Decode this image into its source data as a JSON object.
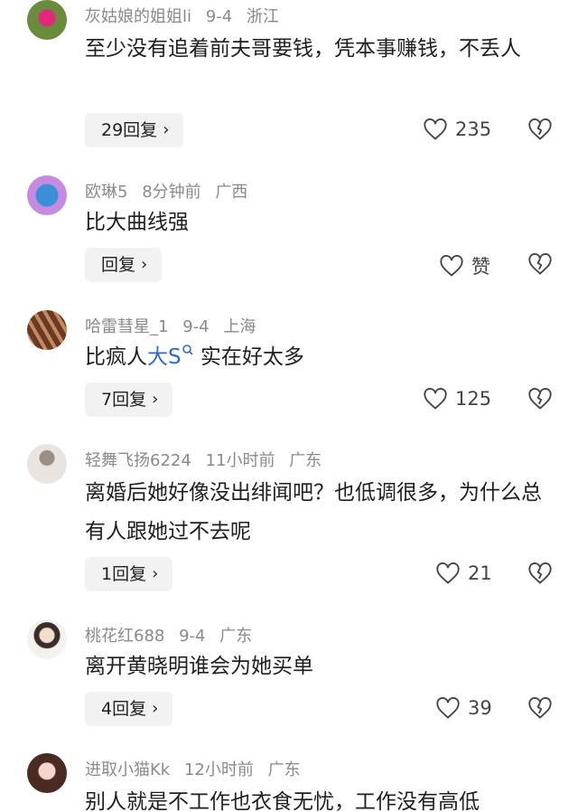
{
  "comments": [
    {
      "user": "灰姑娘的姐姐li",
      "time": "9-4",
      "location": "浙江",
      "text": "至少没有追着前夫哥要钱，凭本事赚钱，不丢人",
      "reply_label": "29回复",
      "likes": "235"
    },
    {
      "user": "欧琳5",
      "time": "8分钟前",
      "location": "广西",
      "text": "比大曲线强",
      "reply_label": "回复",
      "likes": "赞"
    },
    {
      "user": "哈雷彗星_1",
      "time": "9-4",
      "location": "上海",
      "text_before": "比疯人",
      "mention": "大S",
      "text_after": " 实在好太多",
      "reply_label": "7回复",
      "likes": "125"
    },
    {
      "user": "轻舞飞扬6224",
      "time": "11小时前",
      "location": "广东",
      "text": "离婚后她好像没出绯闻吧？也低调很多，为什么总有人跟她过不去呢",
      "reply_label": "1回复",
      "likes": "21"
    },
    {
      "user": "桃花红688",
      "time": "9-4",
      "location": "广东",
      "text": "离开黄晓明谁会为她买单",
      "reply_label": "4回复",
      "likes": "39"
    },
    {
      "user": "进取小猫Kk",
      "time": "12小时前",
      "location": "广东",
      "text": "别人就是不工作也衣食无忧，工作没有高低"
    }
  ],
  "icons": {
    "like": "heart-outline-icon",
    "dislike": "broken-heart-icon",
    "chevron": "chevron-right-icon",
    "mention": "search-icon"
  },
  "colors": {
    "mention": "#2e6cc4",
    "meta": "#8a8a8a",
    "reply_bg": "#f2f2f2"
  }
}
